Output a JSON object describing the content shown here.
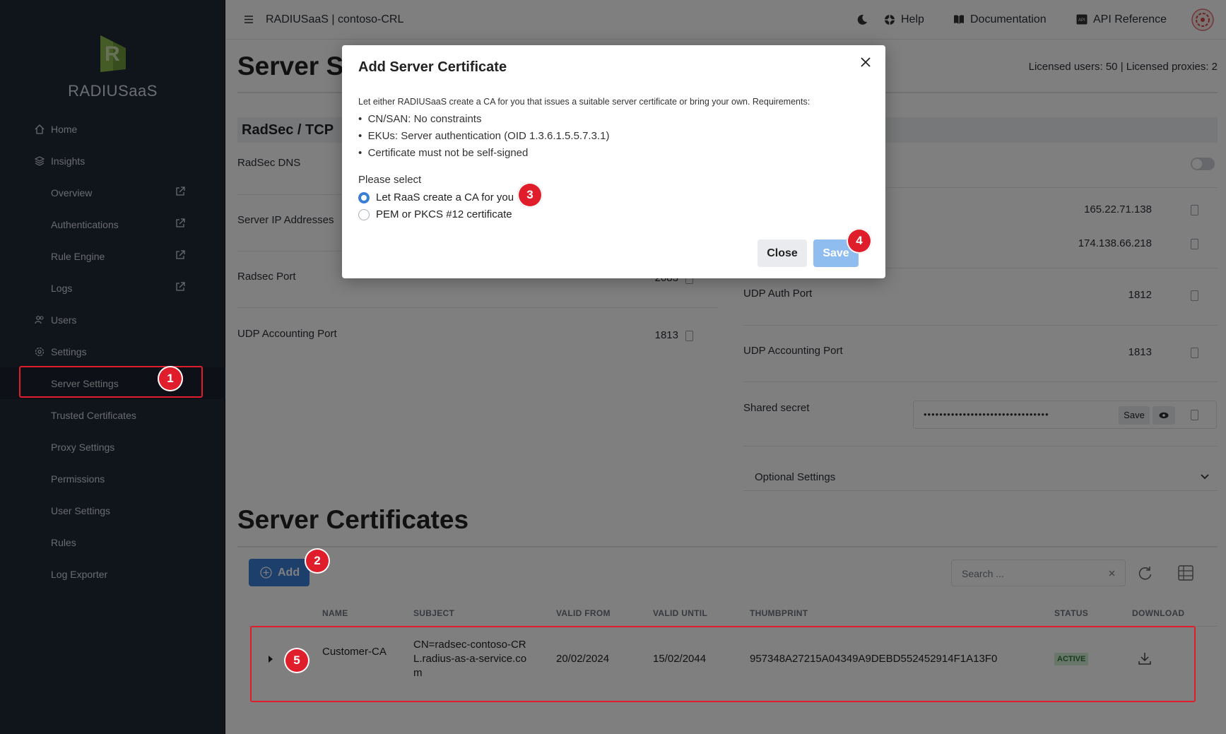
{
  "app": {
    "brand": "RADIUSaaS",
    "title": "RADIUSaaS | contoso-CRL"
  },
  "topnav": {
    "help": "Help",
    "documentation": "Documentation",
    "api_reference": "API Reference"
  },
  "sidebar": {
    "home": "Home",
    "insights": "Insights",
    "overview": "Overview",
    "authentications": "Authentications",
    "rule_engine": "Rule Engine",
    "logs": "Logs",
    "users": "Users",
    "settings": "Settings",
    "server_settings": "Server Settings",
    "trusted_certificates": "Trusted Certificates",
    "proxy_settings": "Proxy Settings",
    "permissions": "Permissions",
    "user_settings": "User Settings",
    "rules": "Rules",
    "log_exporter": "Log Exporter"
  },
  "page": {
    "title": "Server Se",
    "license": "Licensed users: 50 | Licensed proxies: 2"
  },
  "radsec": {
    "header": "RadSec / TCP",
    "dns_label": "RadSec DNS",
    "ip_label": "Server IP Addresses",
    "port_label": "Radsec Port",
    "port_value": "2083",
    "acct_label": "UDP Accounting Port",
    "acct_value": "1813"
  },
  "udp": {
    "ip1": "165.22.71.138",
    "ip2": "174.138.66.218",
    "auth_label": "UDP Auth Port",
    "auth_value": "1812",
    "acct_label": "UDP Accounting Port",
    "acct_value": "1813",
    "secret_label": "Shared secret",
    "secret_value": "••••••••••••••••••••••••••••••••",
    "save": "Save",
    "optional": "Optional Settings"
  },
  "certs": {
    "title": "Server Certificates",
    "add": "Add",
    "search_placeholder": "Search ...",
    "headers": {
      "name": "NAME",
      "subject": "SUBJECT",
      "valid_from": "VALID FROM",
      "valid_until": "VALID UNTIL",
      "thumbprint": "THUMBPRINT",
      "status": "STATUS",
      "download": "DOWNLOAD"
    },
    "row": {
      "name": "Customer-CA",
      "subject": "CN=radsec-contoso-CRL.radius-as-a-service.com",
      "valid_from": "20/02/2024",
      "valid_until": "15/02/2044",
      "thumbprint": "957348A27215A04349A9DEBD552452914F1A13F0",
      "status": "ACTIVE"
    }
  },
  "modal": {
    "title": "Add Server Certificate",
    "intro": "Let either RADIUSaaS create a CA for you that issues a suitable server certificate or bring your own. Requirements:",
    "req1": "CN/SAN: No constraints",
    "req2": "EKUs: Server authentication (OID 1.3.6.1.5.5.7.3.1)",
    "req3": "Certificate must not be self-signed",
    "select": "Please select",
    "opt1": "Let RaaS create a CA for you",
    "opt2": "PEM or PKCS #12 certificate",
    "close": "Close",
    "save": "Save"
  },
  "badges": {
    "b1": "1",
    "b2": "2",
    "b3": "3",
    "b4": "4",
    "b5": "5"
  },
  "colors": {
    "sidebar": "#212936",
    "accent": "#3a7fd6",
    "annotation": "#e01e2b",
    "active": "#2d7a3a"
  }
}
